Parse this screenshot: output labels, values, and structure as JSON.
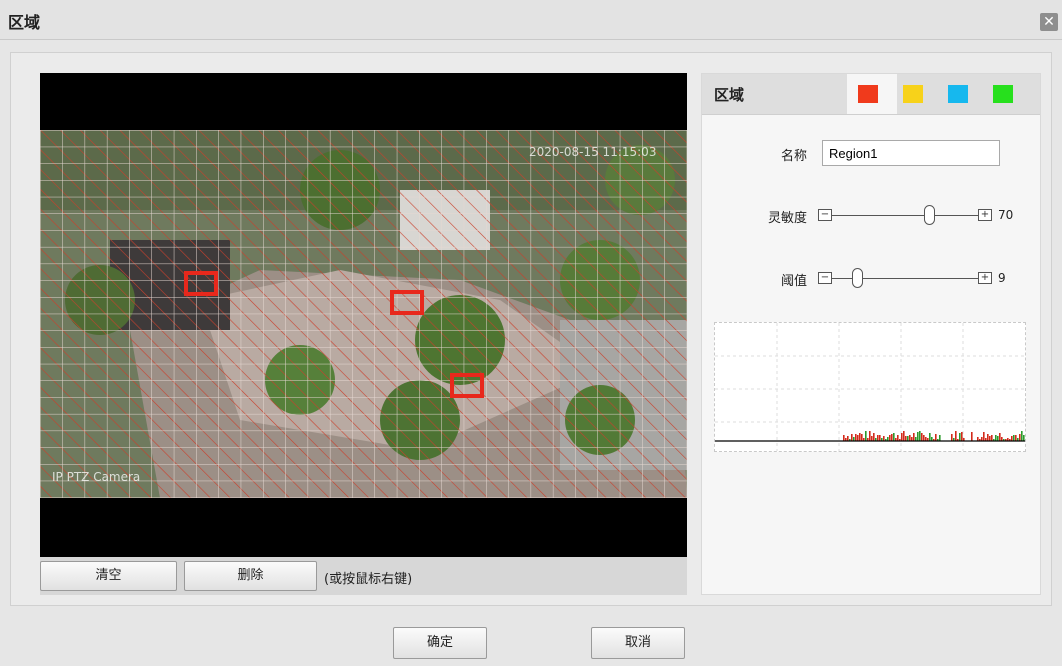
{
  "dialog": {
    "title": "区域",
    "close_glyph": "✕"
  },
  "video": {
    "osd_timestamp": "2020-08-15 11:15:03",
    "osd_camera_name": "IP PTZ Camera",
    "region_color": "#e8281c"
  },
  "controls": {
    "clear_label": "清空",
    "delete_label": "删除",
    "hint": "(或按鼠标右键)"
  },
  "panel": {
    "title": "区域",
    "swatches": [
      {
        "name": "red",
        "color": "#f03a1c",
        "selected": true
      },
      {
        "name": "yellow",
        "color": "#f7d21a",
        "selected": false
      },
      {
        "name": "cyan",
        "color": "#16b8ee",
        "selected": false
      },
      {
        "name": "green",
        "color": "#27e01d",
        "selected": false
      }
    ],
    "name_label": "名称",
    "name_value": "Region1",
    "sensitivity_label": "灵敏度",
    "sensitivity_value": "70",
    "threshold_label": "阈值",
    "threshold_value": "9",
    "minus_glyph": "−",
    "plus_glyph": "+"
  },
  "footer": {
    "ok_label": "确定",
    "cancel_label": "取消"
  }
}
